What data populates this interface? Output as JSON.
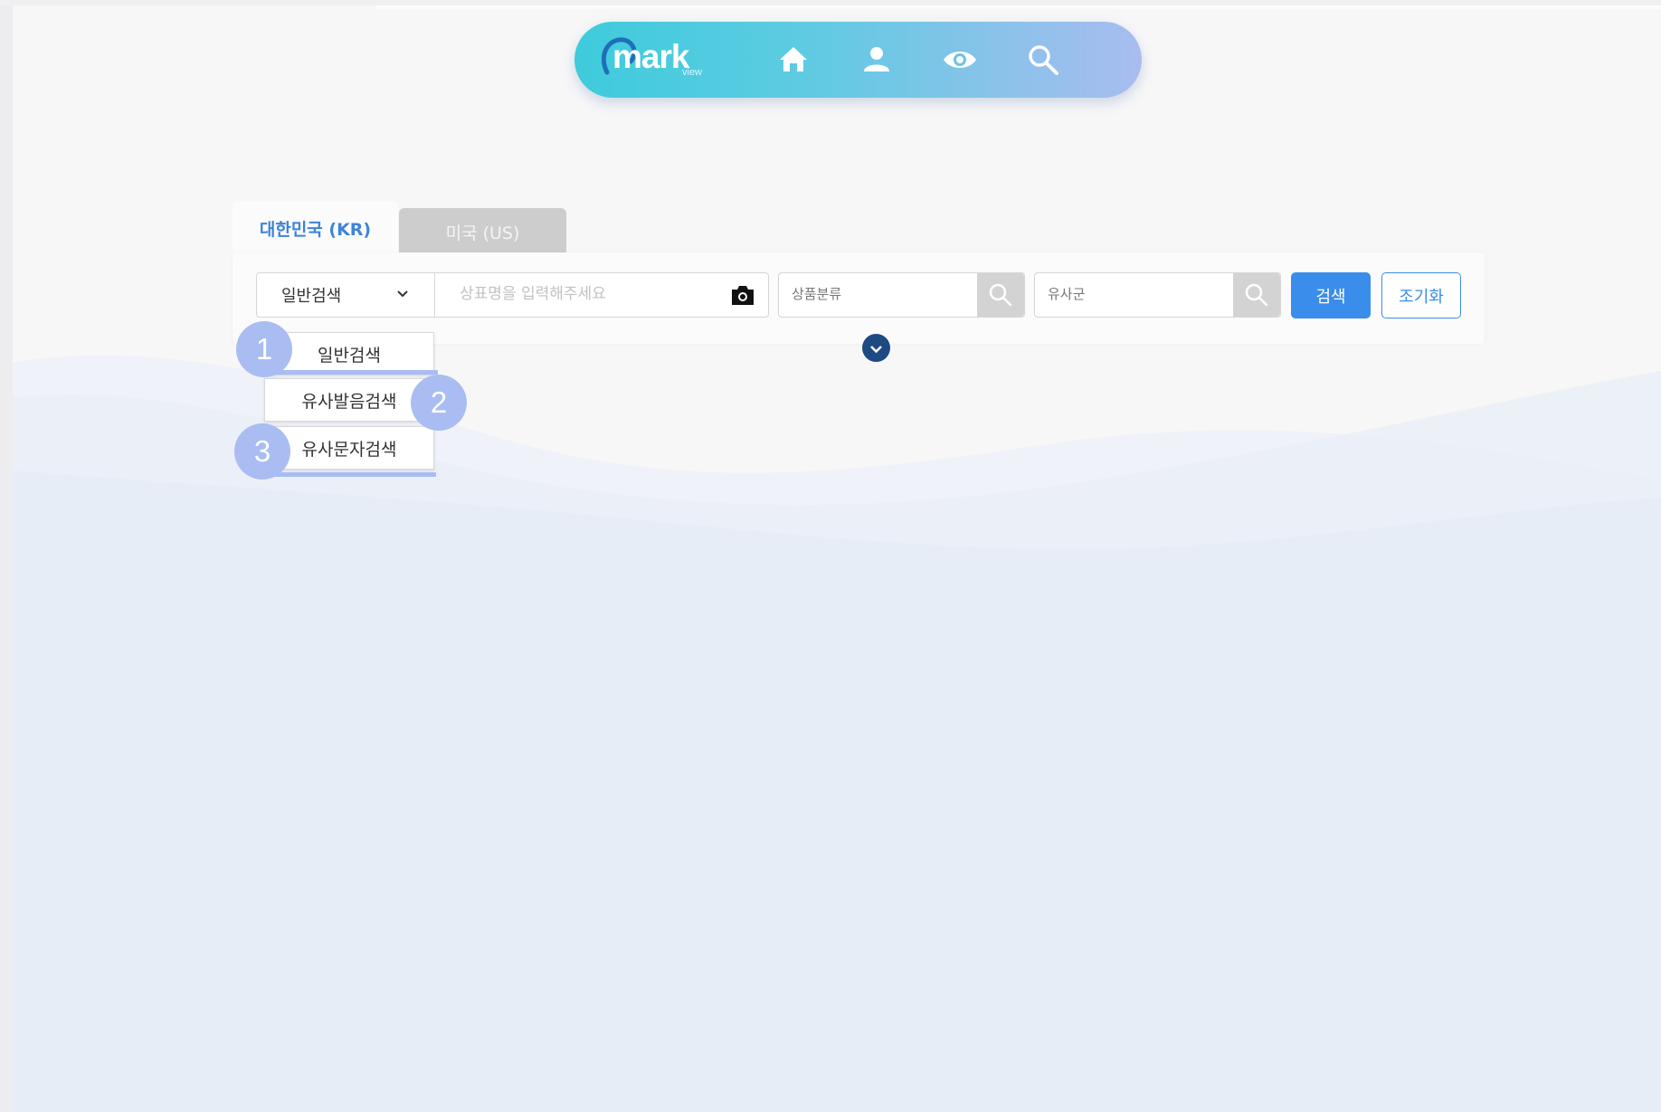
{
  "nav": {
    "logo_text": "mark",
    "logo_sub": "view",
    "icons": [
      "home-icon",
      "user-icon",
      "eye-icon",
      "search-icon"
    ]
  },
  "tabs": [
    {
      "label": "대한민국 (KR)",
      "active": true
    },
    {
      "label": "미국 (US)",
      "active": false
    }
  ],
  "search": {
    "type_selected": "일반검색",
    "name_placeholder": "상표명을 입력해주세요",
    "class_placeholder": "상품분류",
    "similar_placeholder": "유사군",
    "search_label": "검색",
    "reset_label": "조기화"
  },
  "dropdown": {
    "items": [
      "일반검색",
      "유사발음검색",
      "유사문자검색"
    ],
    "badges": [
      "1",
      "2",
      "3"
    ]
  },
  "colors": {
    "accent": "#3a8dea",
    "badge": "#a9bdf2",
    "nav_start": "#3ecbdc",
    "nav_end": "#a9bcf0"
  }
}
